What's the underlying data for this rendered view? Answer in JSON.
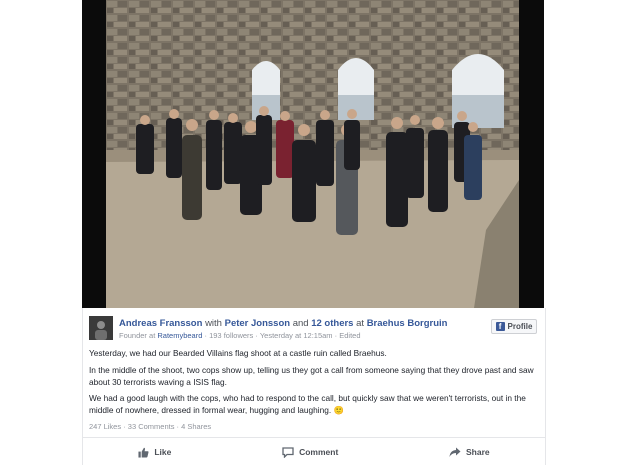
{
  "post": {
    "author": "Andreas Fransson",
    "with_text": "with",
    "tagged_person": "Peter Jonsson",
    "and_text": "and",
    "others": "12 others",
    "at_text": "at",
    "location": "Braehus Borgruin",
    "role_prefix": "Founder at",
    "role_org": "Ratemybeard",
    "followers": "193 followers",
    "timestamp": "Yesterday at 12:15am",
    "edited": "Edited",
    "sep": "·",
    "paragraphs": [
      "Yesterday, we had our Bearded Villains flag shoot at a castle ruin called Braehus.",
      "In the middle of the shoot, two cops show up, telling us they got a call from someone saying that they drove past and saw about 30 terrorists waving a ISIS flag.",
      "We had a good laugh with the cops, who had to respond to the call, but quickly saw that we weren't terrorists, out in the middle of nowhere, dressed in formal wear, hugging and laughing. 🙂"
    ],
    "stats": "247 Likes · 33 Comments · 4 Shares"
  },
  "profile_button": {
    "label": "Profile",
    "icon": "facebook-icon"
  },
  "actions": [
    {
      "label": "Like",
      "icon": "thumbs-up-icon"
    },
    {
      "label": "Comment",
      "icon": "comment-icon"
    },
    {
      "label": "Share",
      "icon": "share-icon"
    }
  ],
  "colors": {
    "link": "#365899",
    "brand": "#3b5998",
    "meta": "#90949c",
    "text": "#1d2129"
  }
}
